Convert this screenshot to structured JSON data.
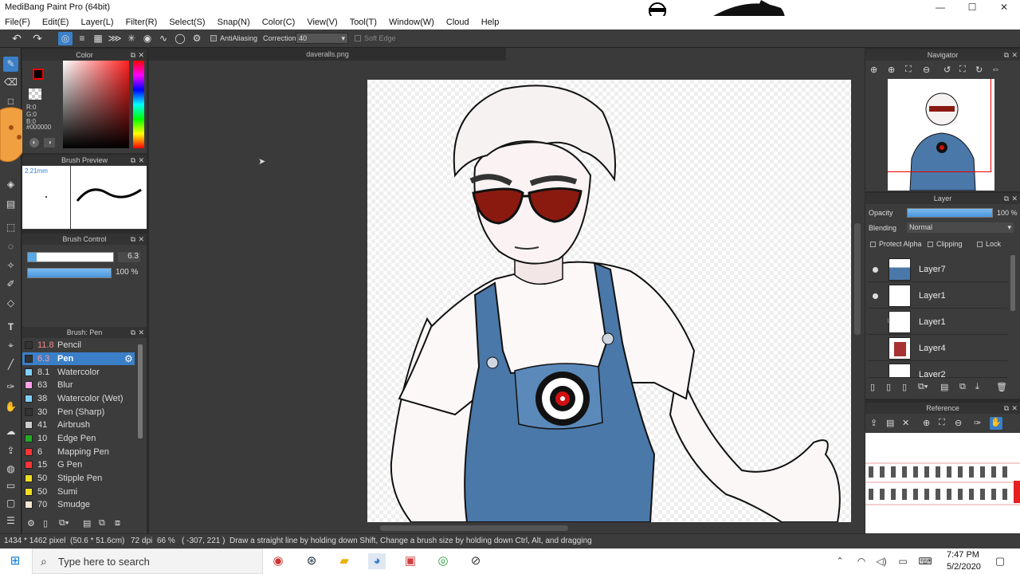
{
  "window": {
    "title": "MediBang Paint Pro (64bit)",
    "minimize": "—",
    "maximize": "☐",
    "close": "✕"
  },
  "menu": [
    "File(F)",
    "Edit(E)",
    "Layer(L)",
    "Filter(R)",
    "Select(S)",
    "Snap(N)",
    "Color(C)",
    "View(V)",
    "Tool(T)",
    "Window(W)",
    "Cloud",
    "Help"
  ],
  "toolbar": {
    "antialiasing_label": "AntiAliasing",
    "correction_label": "Correction",
    "correction_value": "40",
    "soft_edge_label": "Soft Edge"
  },
  "color_panel": {
    "title": "Color",
    "r": "R:0",
    "g": "G:0",
    "b": "B:0",
    "hex": "#000000",
    "fg_color": "#000000",
    "bg_color": "#ffffff"
  },
  "brush_preview": {
    "title": "Brush Preview",
    "size": "2.21mm"
  },
  "brush_control": {
    "title": "Brush Control",
    "size_value": "6.3",
    "opacity_value": "100 %"
  },
  "brush_list": {
    "title": "Brush: Pen",
    "items": [
      {
        "size": "11.8",
        "name": "Pencil",
        "color": "#333333"
      },
      {
        "size": "6.3",
        "name": "Pen",
        "color": "#333333"
      },
      {
        "size": "8.1",
        "name": "Watercolor",
        "color": "#7fd0ff"
      },
      {
        "size": "63",
        "name": "Blur",
        "color": "#ff9fe8"
      },
      {
        "size": "38",
        "name": "Watercolor (Wet)",
        "color": "#7fd0ff"
      },
      {
        "size": "30",
        "name": "Pen (Sharp)",
        "color": "#333333"
      },
      {
        "size": "41",
        "name": "Airbrush",
        "color": "#cccccc"
      },
      {
        "size": "10",
        "name": "Edge Pen",
        "color": "#22aa22"
      },
      {
        "size": "6",
        "name": "Mapping Pen",
        "color": "#ff3333"
      },
      {
        "size": "15",
        "name": "G Pen",
        "color": "#ff3333"
      },
      {
        "size": "50",
        "name": "Stipple Pen",
        "color": "#eedd22"
      },
      {
        "size": "50",
        "name": "Sumi",
        "color": "#eedd22"
      },
      {
        "size": "70",
        "name": "Smudge",
        "color": "#f5e6d0"
      }
    ]
  },
  "document": {
    "tab_name": "daveralls.png"
  },
  "navigator": {
    "title": "Navigator"
  },
  "layer_panel": {
    "title": "Layer",
    "opacity_label": "Opacity",
    "opacity_value": "100 %",
    "opacity_fraction": 1.0,
    "blending_label": "Blending",
    "blending_value": "Normal",
    "protect_alpha_label": "Protect Alpha",
    "clipping_label": "Clipping",
    "lock_label": "Lock",
    "layers": [
      {
        "name": "Layer7",
        "visible": true
      },
      {
        "name": "Layer1",
        "visible": true
      },
      {
        "name": "Layer1",
        "visible": false
      },
      {
        "name": "Layer4",
        "visible": false
      },
      {
        "name": "Layer2",
        "visible": false
      }
    ]
  },
  "reference": {
    "title": "Reference"
  },
  "statusbar": {
    "dimensions": "1434 * 1462 pixel",
    "physical_size": "(50.6 * 51.6cm)",
    "dpi": "72 dpi",
    "zoom": "66 %",
    "cursor": "( -307, 221 )",
    "hint": "Draw a straight line by holding down Shift, Change a brush size by holding down Ctrl, Alt, and dragging"
  },
  "taskbar": {
    "search_placeholder": "Type here to search",
    "time": "7:47 PM",
    "date": "5/2/2020"
  },
  "colors": {
    "accent": "#3a7fc8",
    "overalls": "#4a78a8",
    "glasses": "#8a1a10"
  }
}
